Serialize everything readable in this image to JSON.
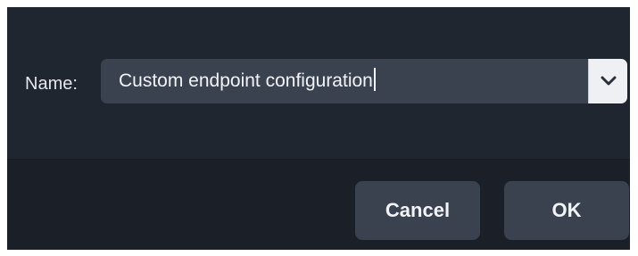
{
  "dialog": {
    "name_label": "Name:",
    "name_value": "Custom endpoint configuration",
    "cancel_label": "Cancel",
    "ok_label": "OK"
  },
  "icons": {
    "dropdown": "chevron-down-icon"
  },
  "colors": {
    "dialog_background": "#202630",
    "footer_background": "#1a1f28",
    "control_background": "#3a4250",
    "dropdown_button_background": "#eef0f3",
    "text": "#f1f3f6"
  }
}
